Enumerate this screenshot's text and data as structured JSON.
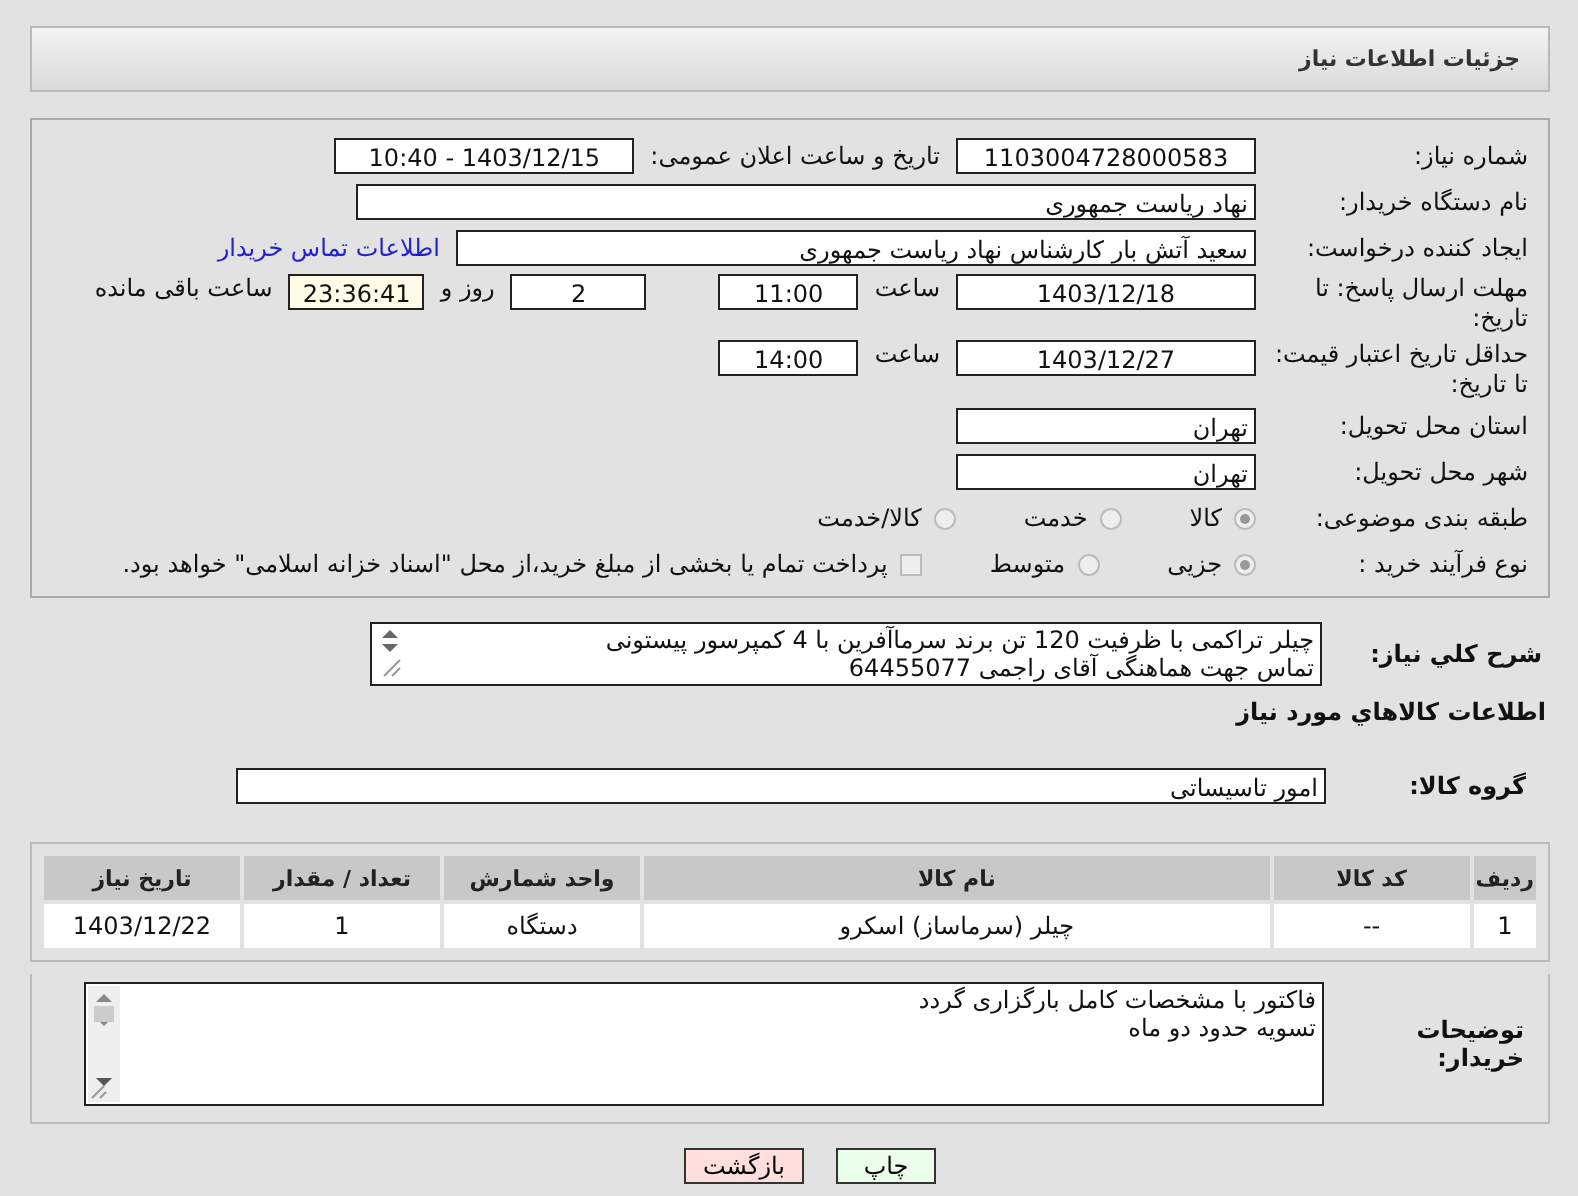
{
  "header": {
    "title": "جزئیات اطلاعات نیاز"
  },
  "details": {
    "need_number": {
      "label": "شماره نیاز:",
      "value": "1103004728000583"
    },
    "announce": {
      "label": "تاریخ و ساعت اعلان عمومی:",
      "value": "1403/12/15 - 10:40"
    },
    "buyer_org": {
      "label": "نام دستگاه خریدار:",
      "value": "نهاد ریاست جمهوری"
    },
    "requester": {
      "label": "ایجاد کننده درخواست:",
      "value": "سعید آتش بار کارشناس نهاد ریاست جمهوری",
      "link": "اطلاعات تماس خریدار"
    },
    "reply_deadline": {
      "label": "مهلت ارسال پاسخ: تا تاریخ:",
      "date": "1403/12/18",
      "time_label": "ساعت",
      "time": "11:00",
      "days": "2",
      "days_label": "روز و",
      "remaining": "23:36:41",
      "remaining_label": "ساعت باقی مانده"
    },
    "price_validity": {
      "label": "حداقل تاریخ اعتبار قیمت: تا تاریخ:",
      "date": "1403/12/27",
      "time_label": "ساعت",
      "time": "14:00"
    },
    "province": {
      "label": "استان محل تحویل:",
      "value": "تهران"
    },
    "city": {
      "label": "شهر محل تحویل:",
      "value": "تهران"
    },
    "category": {
      "label": "طبقه بندی موضوعی:",
      "options": [
        {
          "label": "کالا",
          "selected": true
        },
        {
          "label": "خدمت",
          "selected": false
        },
        {
          "label": "کالا/خدمت",
          "selected": false
        }
      ]
    },
    "purchase_type": {
      "label": "نوع فرآیند خرید :",
      "options": [
        {
          "label": "جزیی",
          "selected": true
        },
        {
          "label": "متوسط",
          "selected": false
        }
      ],
      "treasury": {
        "label": "پرداخت تمام یا بخشی از مبلغ خرید،از محل \"اسناد خزانه اسلامی\" خواهد بود.",
        "checked": false
      }
    }
  },
  "description": {
    "label": "شرح کلي نياز:",
    "lines": [
      "چیلر تراکمی با ظرفیت 120 تن برند سرماآفرین با 4 کمپرسور پیستونی",
      "تماس جهت هماهنگی آقای راجمی 64455077"
    ]
  },
  "goods_heading": "اطلاعات کالاهاي مورد نياز",
  "goods_group": {
    "label": "گروه کالا:",
    "value": "امور تاسیساتی"
  },
  "table": {
    "columns": [
      "ردیف",
      "کد کالا",
      "نام کالا",
      "واحد شمارش",
      "تعداد / مقدار",
      "تاریخ نیاز"
    ],
    "rows": [
      [
        "1",
        "--",
        "چیلر (سرماساز) اسکرو",
        "دستگاه",
        "1",
        "1403/12/22"
      ]
    ]
  },
  "buyer_notes": {
    "label": "توضیحات خریدار:",
    "lines": [
      "فاکتور با مشخصات کامل بارگزاری گردد",
      "تسویه حدود دو ماه"
    ]
  },
  "buttons": [
    {
      "label": "چاپ",
      "kind": "print"
    },
    {
      "label": "بازگشت",
      "kind": "back"
    }
  ]
}
